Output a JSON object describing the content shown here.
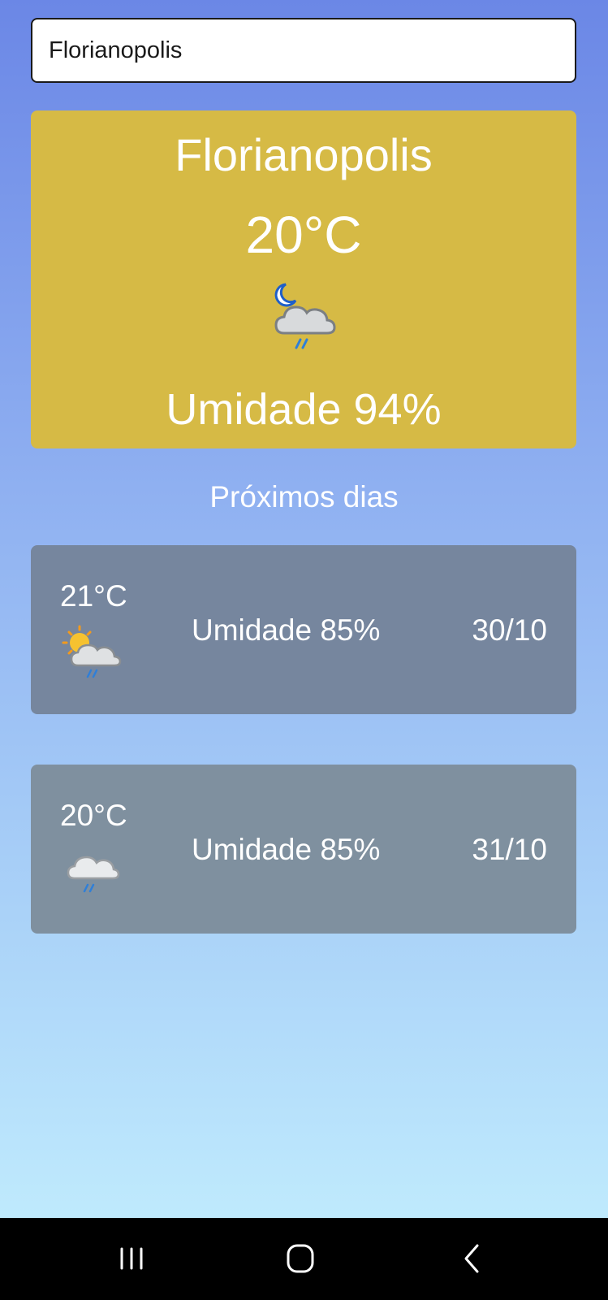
{
  "search": {
    "value": "Florianopolis"
  },
  "current": {
    "city": "Florianopolis",
    "temperature": "20°C",
    "humidity": "Umidade 94%",
    "icon": "night-cloud-rain-icon",
    "card_color": "#d6ba45"
  },
  "forecast": {
    "title": "Próximos dias",
    "days": [
      {
        "temperature": "21°C",
        "humidity": "Umidade 85%",
        "date": "30/10",
        "icon": "sun-cloud-rain-icon",
        "card_color": "#76869e"
      },
      {
        "temperature": "20°C",
        "humidity": "Umidade 85%",
        "date": "31/10",
        "icon": "cloud-rain-icon",
        "card_color": "#7f909f"
      }
    ]
  },
  "navbar": {
    "icons": [
      "recent-apps-icon",
      "home-icon",
      "back-icon"
    ]
  }
}
